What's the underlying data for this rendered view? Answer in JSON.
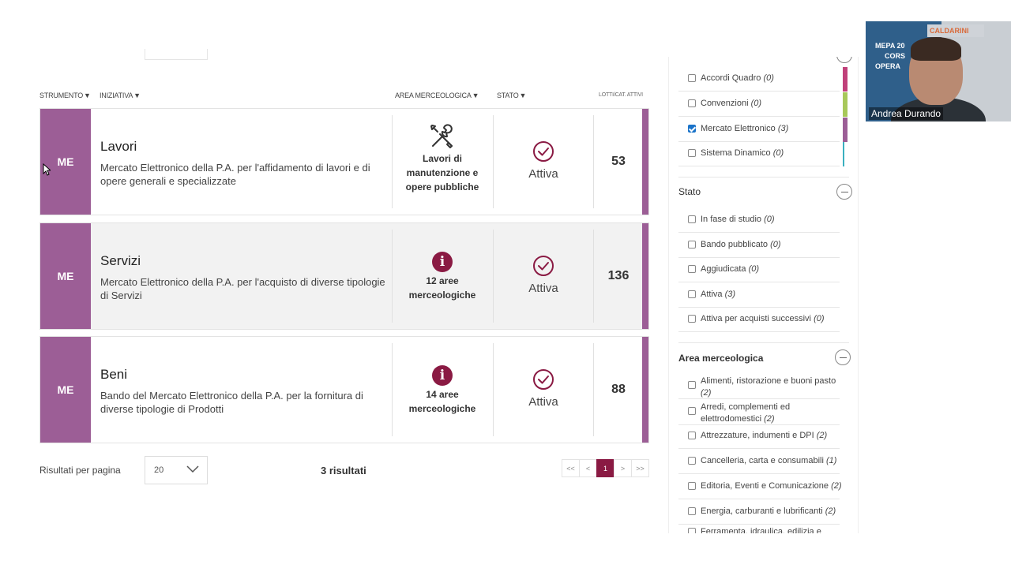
{
  "columns": {
    "strumento": "STRUMENTO",
    "iniziativa": "INIZIATIVA",
    "area": "AREA MERCEOLOGICA",
    "stato": "STATO",
    "lotti": "LOTTI/CAT. ATTIVI"
  },
  "initiatives": [
    {
      "strumento": "ME",
      "title": "Lavori",
      "description": "Mercato Elettronico della P.A. per l'affidamento di lavori e di opere generali e specializzate",
      "area_icon": "wrench-screwdriver-icon",
      "area_label": "Lavori di manutenzione e opere pubbliche",
      "stato": "Attiva",
      "lotti": "53"
    },
    {
      "strumento": "ME",
      "title": "Servizi",
      "description": "Mercato Elettronico della P.A. per l'acquisto di diverse tipologie di Servizi",
      "area_icon": "info-icon",
      "area_label": "12 aree merceologiche",
      "stato": "Attiva",
      "lotti": "136"
    },
    {
      "strumento": "ME",
      "title": "Beni",
      "description": "Bando del Mercato Elettronico della P.A. per la fornitura di diverse tipologie di Prodotti",
      "area_icon": "info-icon",
      "area_label": "14 aree merceologiche",
      "stato": "Attiva",
      "lotti": "88"
    }
  ],
  "pagination": {
    "rpp_label": "Risultati per pagina",
    "rpp_value": "20",
    "results": "3 risultati",
    "first": "<<",
    "prev": "<",
    "current": "1",
    "next": ">",
    "last": ">>"
  },
  "filters": {
    "strumento_items": [
      {
        "label": "Accordi Quadro",
        "count": "(0)",
        "checked": false,
        "color": "#c0407a"
      },
      {
        "label": "Convenzioni",
        "count": "(0)",
        "checked": false,
        "color": "#a8c85a"
      },
      {
        "label": "Mercato Elettronico",
        "count": "(3)",
        "checked": true,
        "color": "#9c5e96"
      },
      {
        "label": "Sistema Dinamico",
        "count": "(0)",
        "checked": false,
        "color": "#3ab0c0"
      }
    ],
    "stato_title": "Stato",
    "stato_items": [
      {
        "label": "In fase di studio",
        "count": "(0)"
      },
      {
        "label": "Bando pubblicato",
        "count": "(0)"
      },
      {
        "label": "Aggiudicata",
        "count": "(0)"
      },
      {
        "label": "Attiva",
        "count": "(3)"
      },
      {
        "label": "Attiva per acquisti successivi",
        "count": "(0)"
      }
    ],
    "area_title": "Area merceologica",
    "area_items": [
      {
        "label": "Alimenti, ristorazione e buoni pasto",
        "count": "(2)"
      },
      {
        "label": "Arredi, complementi ed elettrodomestici",
        "count": "(2)"
      },
      {
        "label": "Attrezzature, indumenti e DPI",
        "count": "(2)"
      },
      {
        "label": "Cancelleria, carta e consumabili",
        "count": "(1)"
      },
      {
        "label": "Editoria, Eventi e Comunicazione",
        "count": "(2)"
      },
      {
        "label": "Energia, carburanti e lubrificanti",
        "count": "(2)"
      },
      {
        "label": "Ferramenta, idraulica, edilizia e",
        "count": ""
      }
    ]
  },
  "video": {
    "participant": "Andrea Durando",
    "logo": "CALDARINI",
    "slide_lines": [
      "MEPA 20",
      "CORS",
      "OPERA"
    ]
  },
  "colors": {
    "me_purple": "#9c5e96",
    "accent_maroon": "#8a1a43",
    "checkbox_blue": "#1a73c9"
  }
}
